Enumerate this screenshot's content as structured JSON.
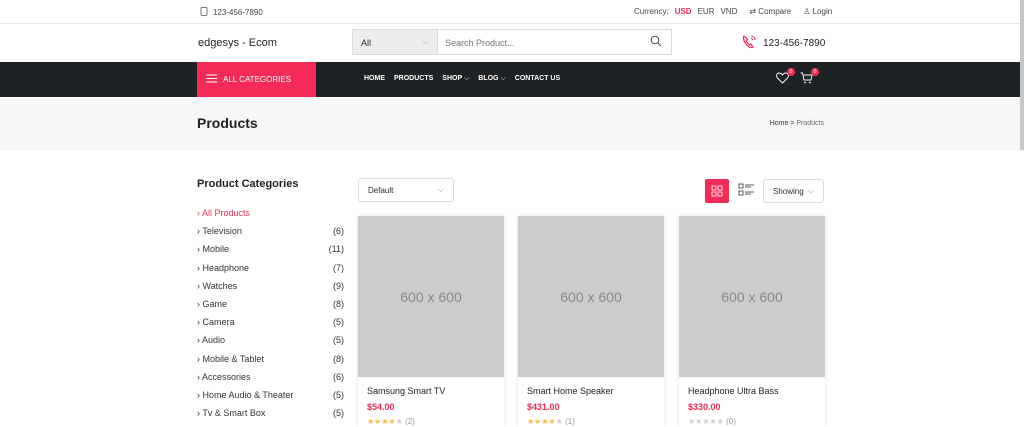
{
  "topbar": {
    "phone": "123-456-7890",
    "currency_label": "Currency:",
    "currencies": [
      "USD",
      "EUR",
      "VND"
    ],
    "compare": "Compare",
    "login": "Login"
  },
  "header": {
    "brand": "edgesys - Ecom",
    "search_category": "All",
    "search_placeholder": "Search Product...",
    "hotline": "123-456-7890"
  },
  "nav": {
    "all_categories": "ALL CATEGORIES",
    "menu": [
      "HOME",
      "PRODUCTS",
      "SHOP",
      "BLOG",
      "CONTACT US"
    ],
    "wishlist_count": "0",
    "cart_count": "0"
  },
  "page": {
    "title": "Products",
    "breadcrumb_home": "Home",
    "breadcrumb_sep": ">",
    "breadcrumb_current": "Products"
  },
  "sidebar": {
    "title": "Product Categories",
    "items": [
      {
        "label": "All Products",
        "count": ""
      },
      {
        "label": "Television",
        "count": "(6)"
      },
      {
        "label": "Mobile",
        "count": "(11)"
      },
      {
        "label": "Headphone",
        "count": "(7)"
      },
      {
        "label": "Watches",
        "count": "(9)"
      },
      {
        "label": "Game",
        "count": "(8)"
      },
      {
        "label": "Camera",
        "count": "(5)"
      },
      {
        "label": "Audio",
        "count": "(5)"
      },
      {
        "label": "Mobile & Tablet",
        "count": "(8)"
      },
      {
        "label": "Accessories",
        "count": "(6)"
      },
      {
        "label": "Home Audio & Theater",
        "count": "(5)"
      },
      {
        "label": "Tv & Smart Box",
        "count": "(5)"
      }
    ]
  },
  "toolbar": {
    "sort": "Default",
    "showing": "Showing"
  },
  "products": [
    {
      "image_text": "600 x 600",
      "name": "Samsung Smart TV",
      "price": "$54.00",
      "rating": 4,
      "reviews": "(2)"
    },
    {
      "image_text": "600 x 600",
      "name": "Smart Home Speaker",
      "price": "$431.00",
      "rating": 4,
      "reviews": "(1)"
    },
    {
      "image_text": "600 x 600",
      "name": "Headphone Ultra Bass",
      "price": "$330.00",
      "rating": 0,
      "reviews": "(0)"
    }
  ],
  "colors": {
    "accent": "#f32b56",
    "nav_bg": "#1f2224",
    "star": "#f6bc3e"
  }
}
